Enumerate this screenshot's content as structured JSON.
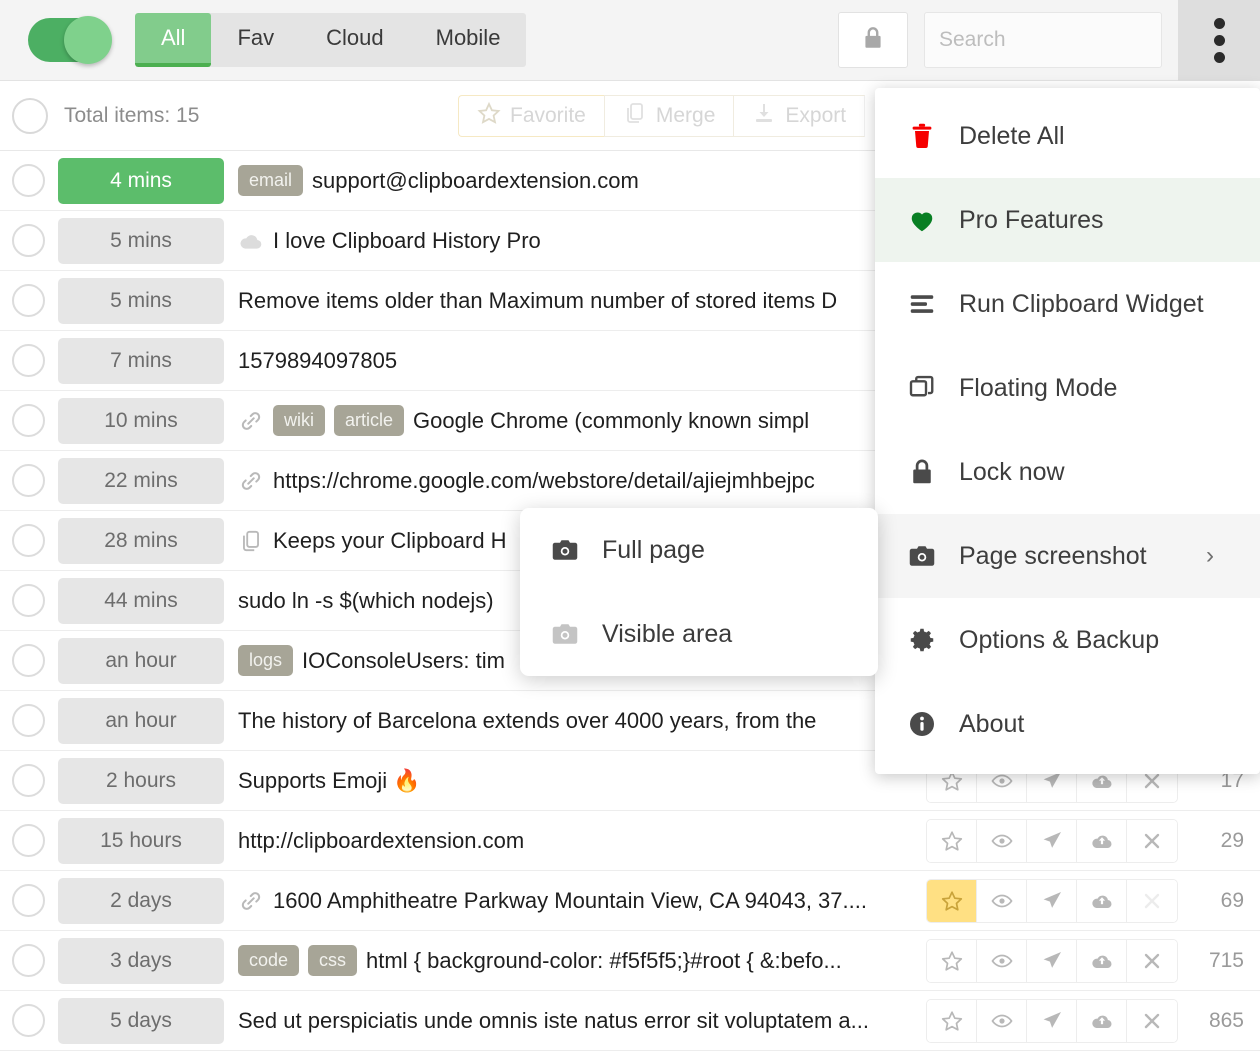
{
  "topbar": {
    "toggle_state": "on",
    "tabs": [
      {
        "label": "All",
        "active": true
      },
      {
        "label": "Fav",
        "active": false
      },
      {
        "label": "Cloud",
        "active": false
      },
      {
        "label": "Mobile",
        "active": false
      }
    ],
    "lock_button": "lock-icon",
    "search": {
      "value": "",
      "placeholder": "Search"
    },
    "kebab": "more-vertical-icon"
  },
  "subbar": {
    "total_items": "Total items: 15",
    "actions": [
      {
        "label": "Favorite",
        "icon": "star-icon"
      },
      {
        "label": "Merge",
        "icon": "merge-icon"
      },
      {
        "label": "Export",
        "icon": "download-icon"
      }
    ]
  },
  "rows": [
    {
      "time": "4 mins",
      "fresh": true,
      "icon": "",
      "tags": [
        "email"
      ],
      "text": "support@clipboardextension.com",
      "count": "",
      "fav": false
    },
    {
      "time": "5 mins",
      "fresh": false,
      "icon": "cloud",
      "tags": [],
      "text": "I love Clipboard History Pro",
      "count": "",
      "fav": false
    },
    {
      "time": "5 mins",
      "fresh": false,
      "icon": "",
      "tags": [],
      "text": "Remove items older than Maximum number of stored items D",
      "count": "",
      "fav": false
    },
    {
      "time": "7 mins",
      "fresh": false,
      "icon": "",
      "tags": [],
      "text": "1579894097805",
      "count": "",
      "fav": false
    },
    {
      "time": "10 mins",
      "fresh": false,
      "icon": "link",
      "tags": [
        "wiki",
        "article"
      ],
      "text": "Google Chrome (commonly known simpl",
      "count": "",
      "fav": false
    },
    {
      "time": "22 mins",
      "fresh": false,
      "icon": "link",
      "tags": [],
      "text": "https://chrome.google.com/webstore/detail/ajiejmhbejpc",
      "count": "",
      "fav": false
    },
    {
      "time": "28 mins",
      "fresh": false,
      "icon": "copy",
      "tags": [],
      "text": "Keeps your Clipboard H",
      "count": "",
      "fav": false
    },
    {
      "time": "44 mins",
      "fresh": false,
      "icon": "",
      "tags": [],
      "text": "sudo ln -s $(which nodejs)",
      "count": "",
      "fav": false
    },
    {
      "time": "an hour",
      "fresh": false,
      "icon": "",
      "tags": [
        "logs"
      ],
      "text": "IOConsoleUsers: tim",
      "count": "",
      "fav": false
    },
    {
      "time": "an hour",
      "fresh": false,
      "icon": "",
      "tags": [],
      "text": "The history of Barcelona extends over 4000 years, from the",
      "count": "",
      "fav": false
    },
    {
      "time": "2 hours",
      "fresh": false,
      "icon": "",
      "tags": [],
      "text": "Supports Emoji 🔥",
      "count": "17",
      "fav": false
    },
    {
      "time": "15 hours",
      "fresh": false,
      "icon": "",
      "tags": [],
      "text": "http://clipboardextension.com",
      "count": "29",
      "fav": false
    },
    {
      "time": "2 days",
      "fresh": false,
      "icon": "link",
      "tags": [],
      "text": "1600 Amphitheatre Parkway Mountain View, CA 94043, 37....",
      "count": "69",
      "fav": true
    },
    {
      "time": "3 days",
      "fresh": false,
      "icon": "",
      "tags": [
        "code",
        "css"
      ],
      "text": "html { background-color: #f5f5f5;}#root { &:befo...",
      "count": "715",
      "fav": false
    },
    {
      "time": "5 days",
      "fresh": false,
      "icon": "",
      "tags": [],
      "text": "Sed ut perspiciatis unde omnis iste natus error sit voluptatem a...",
      "count": "865",
      "fav": false
    }
  ],
  "row_action_icons": [
    "star-icon",
    "eye-icon",
    "send-icon",
    "cloud-upload-icon",
    "close-icon"
  ],
  "menu": {
    "items": [
      {
        "label": "Delete All",
        "icon": "trash-icon",
        "highlight": "none",
        "chevron": ""
      },
      {
        "label": "Pro Features",
        "icon": "heart-icon",
        "highlight": "green",
        "chevron": ""
      },
      {
        "label": "Run Clipboard Widget",
        "icon": "list-icon",
        "highlight": "none",
        "chevron": ""
      },
      {
        "label": "Floating Mode",
        "icon": "windows-icon",
        "highlight": "none",
        "chevron": ""
      },
      {
        "label": "Lock now",
        "icon": "lock-icon",
        "highlight": "none",
        "chevron": ""
      },
      {
        "label": "Page screenshot",
        "icon": "camera-icon",
        "highlight": "grey",
        "chevron": "›"
      },
      {
        "label": "Options & Backup",
        "icon": "gear-icon",
        "highlight": "none",
        "chevron": ""
      },
      {
        "label": "About",
        "icon": "info-icon",
        "highlight": "none",
        "chevron": ""
      }
    ]
  },
  "submenu": {
    "items": [
      {
        "label": "Full page",
        "icon": "camera-icon",
        "dim": false
      },
      {
        "label": "Visible area",
        "icon": "camera-icon",
        "dim": true
      }
    ]
  },
  "colors": {
    "accent_green": "#5cbd6b",
    "tab_active": "#82cc8c",
    "tab_underline": "#4caf50",
    "tag_grey": "#a7a597",
    "fav_yellow": "#ffe083",
    "delete_red": "#f60000",
    "pro_green": "#087f23"
  }
}
